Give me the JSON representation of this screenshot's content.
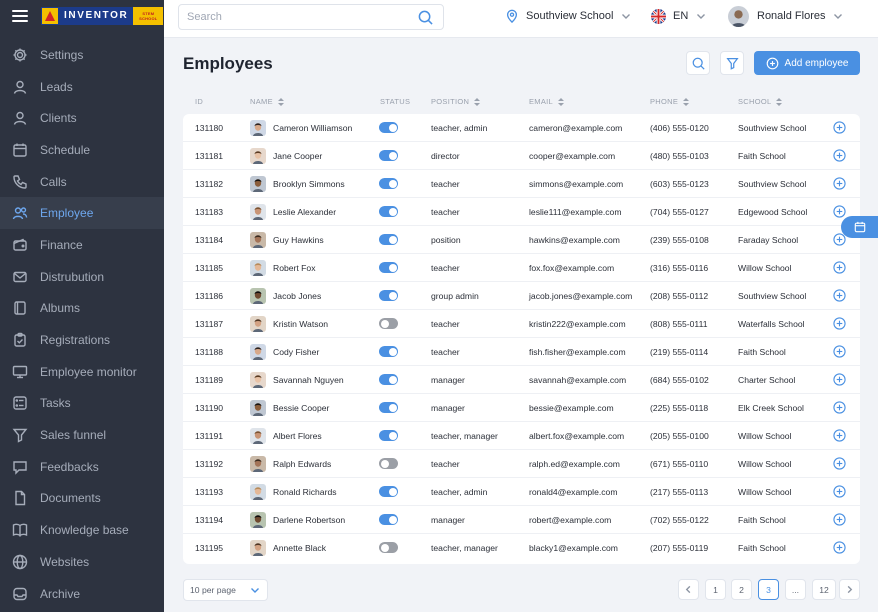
{
  "brand": {
    "name": "INVENTOR",
    "sub_top": "STEM",
    "sub_bottom": "SCHOOL"
  },
  "sidebar": {
    "items": [
      {
        "label": "Settings",
        "icon": "gear-icon"
      },
      {
        "label": "Leads",
        "icon": "user-icon"
      },
      {
        "label": "Clients",
        "icon": "user-icon"
      },
      {
        "label": "Schedule",
        "icon": "calendar-icon"
      },
      {
        "label": "Calls",
        "icon": "phone-icon"
      },
      {
        "label": "Employee",
        "icon": "users-icon",
        "active": true
      },
      {
        "label": "Finance",
        "icon": "wallet-icon"
      },
      {
        "label": "Distrubution",
        "icon": "mail-icon"
      },
      {
        "label": "Albums",
        "icon": "album-icon"
      },
      {
        "label": "Registrations",
        "icon": "clipboard-icon"
      },
      {
        "label": "Employee monitor",
        "icon": "monitor-icon"
      },
      {
        "label": "Tasks",
        "icon": "tasks-icon"
      },
      {
        "label": "Sales funnel",
        "icon": "funnel-icon"
      },
      {
        "label": "Feedbacks",
        "icon": "chat-icon"
      },
      {
        "label": "Documents",
        "icon": "document-icon"
      },
      {
        "label": "Knowledge base",
        "icon": "book-icon"
      },
      {
        "label": "Websites",
        "icon": "globe-icon"
      },
      {
        "label": "Archive",
        "icon": "archive-icon"
      }
    ]
  },
  "topbar": {
    "search_placeholder": "Search",
    "school": "Southview School",
    "language": "EN",
    "user": "Ronald Flores"
  },
  "page": {
    "title": "Employees",
    "add_label": "Add employee"
  },
  "table": {
    "headers": {
      "id": "ID",
      "name": "NAME",
      "status": "STATUS",
      "position": "POSITION",
      "email": "EMAIL",
      "phone": "PHONE",
      "school": "SCHOOL"
    },
    "rows": [
      {
        "id": "131180",
        "name": "Cameron Williamson",
        "status": true,
        "position": "teacher, admin",
        "email": "cameron@example.com",
        "phone": "(406) 555-0120",
        "school": "Southview School"
      },
      {
        "id": "131181",
        "name": "Jane Cooper",
        "status": true,
        "position": "director",
        "email": "cooper@example.com",
        "phone": "(480) 555-0103",
        "school": "Faith School"
      },
      {
        "id": "131182",
        "name": "Brooklyn Simmons",
        "status": true,
        "position": "teacher",
        "email": "simmons@example.com",
        "phone": "(603) 555-0123",
        "school": "Southview School"
      },
      {
        "id": "131183",
        "name": "Leslie Alexander",
        "status": true,
        "position": "teacher",
        "email": "leslie111@example.com",
        "phone": "(704) 555-0127",
        "school": "Edgewood School"
      },
      {
        "id": "131184",
        "name": "Guy Hawkins",
        "status": true,
        "position": "position",
        "email": "hawkins@example.com",
        "phone": "(239) 555-0108",
        "school": "Faraday School"
      },
      {
        "id": "131185",
        "name": "Robert Fox",
        "status": true,
        "position": "teacher",
        "email": "fox.fox@example.com",
        "phone": "(316) 555-0116",
        "school": "Willow School"
      },
      {
        "id": "131186",
        "name": "Jacob Jones",
        "status": true,
        "position": "group admin",
        "email": "jacob.jones@example.com",
        "phone": "(208) 555-0112",
        "school": "Southview School"
      },
      {
        "id": "131187",
        "name": "Kristin Watson",
        "status": false,
        "position": "teacher",
        "email": "kristin222@example.com",
        "phone": "(808) 555-0111",
        "school": "Waterfalls School"
      },
      {
        "id": "131188",
        "name": "Cody Fisher",
        "status": true,
        "position": "teacher",
        "email": "fish.fisher@example.com",
        "phone": "(219) 555-0114",
        "school": "Faith School"
      },
      {
        "id": "131189",
        "name": "Savannah Nguyen",
        "status": true,
        "position": "manager",
        "email": "savannah@example.com",
        "phone": "(684) 555-0102",
        "school": "Charter School"
      },
      {
        "id": "131190",
        "name": "Bessie Cooper",
        "status": true,
        "position": "manager",
        "email": "bessie@example.com",
        "phone": "(225) 555-0118",
        "school": "Elk Creek School"
      },
      {
        "id": "131191",
        "name": "Albert Flores",
        "status": true,
        "position": "teacher, manager",
        "email": "albert.fox@example.com",
        "phone": "(205) 555-0100",
        "school": "Willow School"
      },
      {
        "id": "131192",
        "name": "Ralph Edwards",
        "status": false,
        "position": "teacher",
        "email": "ralph.ed@example.com",
        "phone": "(671) 555-0110",
        "school": "Willow School"
      },
      {
        "id": "131193",
        "name": "Ronald Richards",
        "status": true,
        "position": "teacher, admin",
        "email": "ronald4@example.com",
        "phone": "(217) 555-0113",
        "school": "Willow  School"
      },
      {
        "id": "131194",
        "name": "Darlene Robertson",
        "status": true,
        "position": "manager",
        "email": "robert@example.com",
        "phone": "(702) 555-0122",
        "school": "Faith School"
      },
      {
        "id": "131195",
        "name": "Annette Black",
        "status": false,
        "position": "teacher, manager",
        "email": "blacky1@example.com",
        "phone": "(207) 555-0119",
        "school": "Faith School"
      }
    ]
  },
  "pagination": {
    "per_page": "10 per page",
    "pages": [
      "1",
      "2",
      "3",
      "...",
      "12"
    ],
    "current": "3"
  },
  "colors": {
    "accent": "#4a90e2",
    "sidebar_bg": "#2d3340",
    "toggle_off": "#9b9fa6"
  }
}
